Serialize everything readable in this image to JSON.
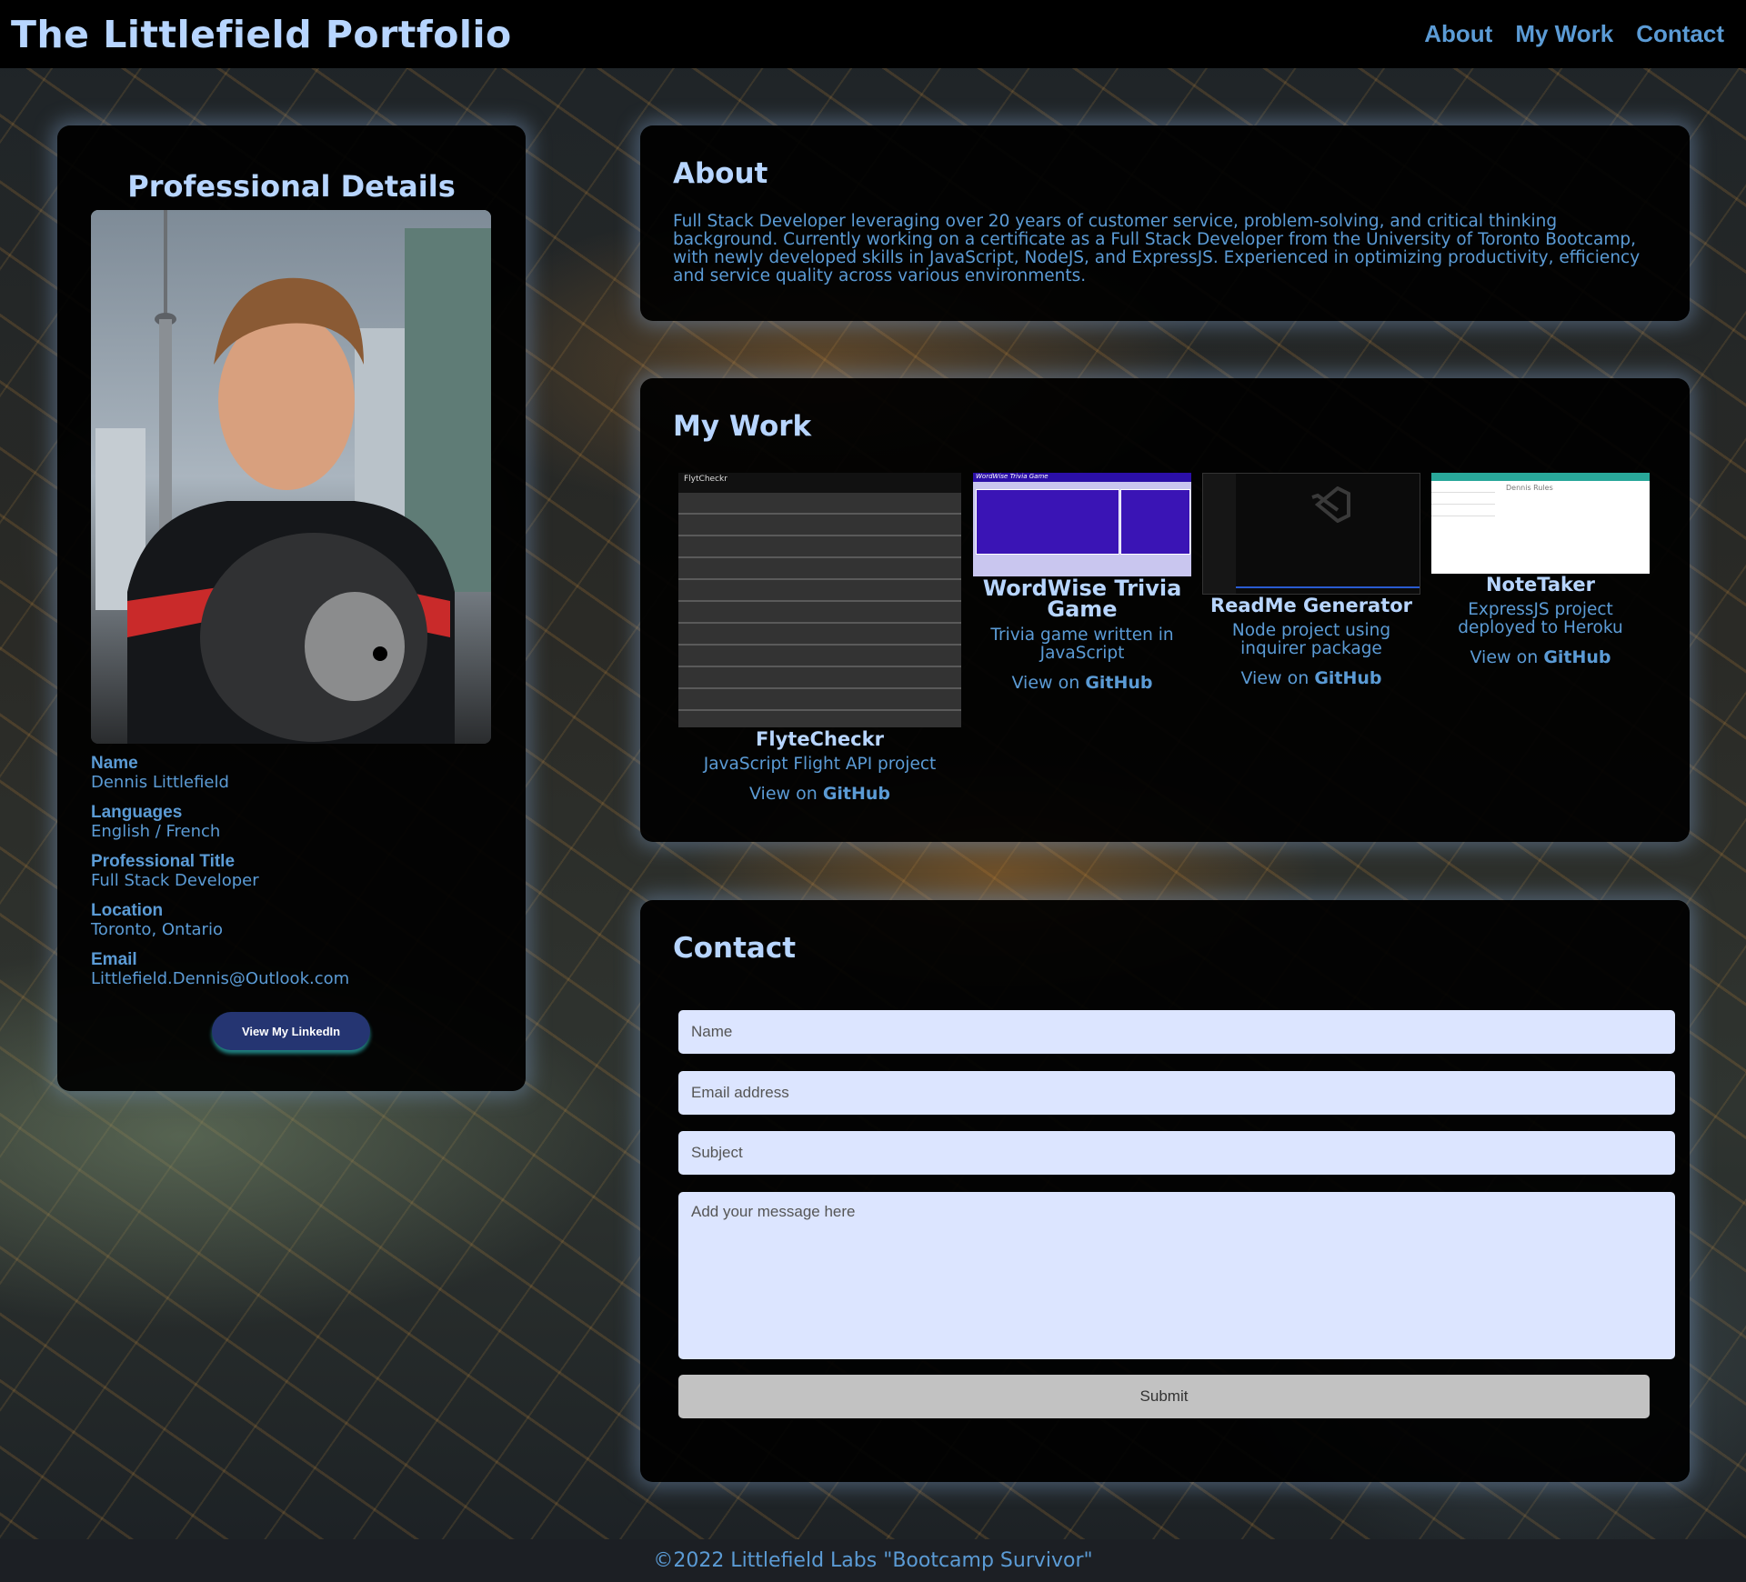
{
  "header": {
    "title": "The Littlefield Portfolio",
    "nav": [
      "About",
      "My Work",
      "Contact"
    ]
  },
  "details": {
    "heading": "Professional Details",
    "items": [
      {
        "label": "Name",
        "value": "Dennis Littlefield"
      },
      {
        "label": "Languages",
        "value": "English / French"
      },
      {
        "label": "Professional Title",
        "value": "Full Stack Developer"
      },
      {
        "label": "Location",
        "value": "Toronto, Ontario"
      },
      {
        "label": "Email",
        "value": "Littlefield.Dennis@Outlook.com"
      }
    ],
    "linkedin_label": "View My LinkedIn"
  },
  "about": {
    "heading": "About",
    "text": "Full Stack Developer leveraging over 20 years of customer service, problem-solving, and critical thinking background. Currently working on a certificate as a Full Stack Developer from the University of Toronto Bootcamp, with newly developed skills in JavaScript, NodeJS, and ExpressJS. Experienced in optimizing productivity, efficiency and service quality across various environments."
  },
  "work": {
    "heading": "My Work",
    "link_prefix": "View on ",
    "link_strong": "GitHub",
    "projects": [
      {
        "title": "FlyteCheckr",
        "desc": "JavaScript Flight API project",
        "thumb_text": "FlytCheckr"
      },
      {
        "title": "WordWise Trivia Game",
        "desc": "Trivia game written in JavaScript",
        "thumb_text": "WordWise Trivia Game"
      },
      {
        "title": "ReadMe Generator",
        "desc": "Node project using inquirer package"
      },
      {
        "title": "NoteTaker",
        "desc": "ExpressJS project deployed to Heroku",
        "thumb_text": "Dennis Rules"
      }
    ]
  },
  "contact": {
    "heading": "Contact",
    "name_placeholder": "Name",
    "email_placeholder": "Email address",
    "subject_placeholder": "Subject",
    "message_placeholder": "Add your message here",
    "submit_label": "Submit"
  },
  "footer": {
    "text": "©2022 Littlefield Labs \"Bootcamp Survivor\""
  },
  "colors": {
    "accent": "#5b9bd5",
    "heading": "#b7d5ff",
    "panel": "#000000",
    "input_bg": "#dce5ff",
    "linkedin_bg": "#253572"
  }
}
